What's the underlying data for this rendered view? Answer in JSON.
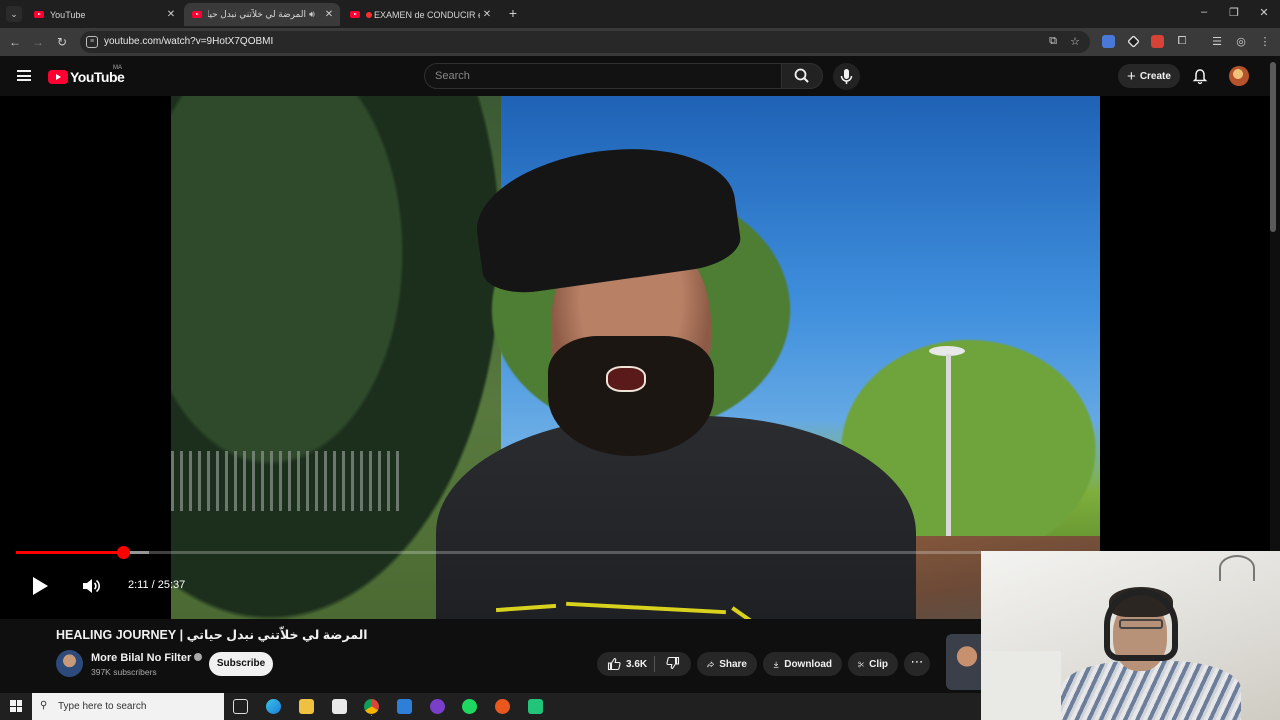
{
  "browser": {
    "tabs": [
      {
        "title": "YouTube",
        "active": false
      },
      {
        "title": "المرضة لي خلاّتني نبدل حياتي",
        "active": true
      },
      {
        "title": "EXAMEN de CONDUCIR en",
        "active": false
      }
    ],
    "url": "youtube.com/watch?v=9HotX7QOBMI"
  },
  "youtube": {
    "logo_text": "YouTube",
    "country_code": "MA",
    "search_placeholder": "Search",
    "create_label": "Create"
  },
  "player": {
    "current_time": "2:11",
    "duration": "25:37",
    "time_display": "2:11 / 25:37",
    "progress_fraction": 0.0853,
    "buffered_fraction": 0.106
  },
  "video": {
    "title": "المرضة لي خلاّتني نبدل حياتي | HEALING JOURNEY",
    "channel_name": "More Bilal No Filter",
    "subscribers": "397K subscribers",
    "subscribe_label": "Subscribe",
    "likes": "3.6K",
    "share_label": "Share",
    "download_label": "Download",
    "clip_label": "Clip"
  },
  "taskbar": {
    "search_placeholder": "Type here to search"
  },
  "colors": {
    "youtube_red": "#ff0033",
    "progress_red": "#ff0000",
    "background": "#0f0f0f"
  }
}
